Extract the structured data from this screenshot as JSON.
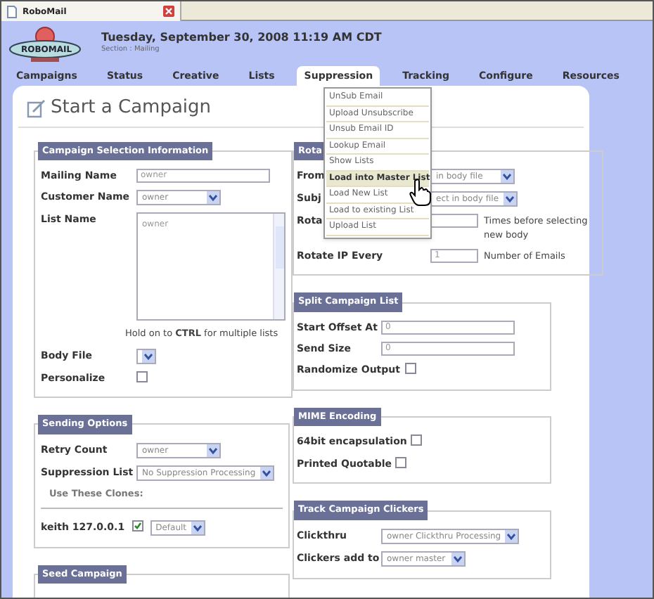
{
  "browser_tab": {
    "title": "RoboMail"
  },
  "header": {
    "logo": "ROBOMAIL",
    "date": "Tuesday, September 30, 2008 11:19 AM CDT",
    "section": "Section : Mailing"
  },
  "nav": [
    {
      "label": "Campaigns",
      "selected": false
    },
    {
      "label": "Status",
      "selected": false
    },
    {
      "label": "Creative",
      "selected": false
    },
    {
      "label": "Lists",
      "selected": false
    },
    {
      "label": "Suppression",
      "selected": true
    },
    {
      "label": "Tracking",
      "selected": false
    },
    {
      "label": "Configure",
      "selected": false
    },
    {
      "label": "Resources",
      "selected": false
    }
  ],
  "menu": {
    "items": [
      {
        "label": "UnSub Email",
        "hovered": false
      },
      {
        "label": "Upload Unsubscribe",
        "hovered": false
      },
      {
        "label": "Unsub Email ID",
        "hovered": false
      },
      {
        "label": "Lookup Email",
        "hovered": false
      },
      {
        "label": "Show Lists",
        "hovered": false
      },
      {
        "label": "Load into Master List",
        "hovered": true
      },
      {
        "label": "Load New List",
        "hovered": false
      },
      {
        "label": "Load to existing List",
        "hovered": false
      },
      {
        "label": "Upload List",
        "hovered": false
      }
    ]
  },
  "page_title": "Start a Campaign",
  "left_sections": [
    {
      "legend": "Campaign Selection Information",
      "rows": [
        {
          "kind": "text",
          "label": "Mailing Name",
          "value": "owner"
        },
        {
          "kind": "select",
          "label": "Customer Name",
          "value": "owner"
        },
        {
          "kind": "listbox",
          "label": "List Name",
          "items": [
            "owner"
          ]
        },
        {
          "kind": "note",
          "text": "Hold on to **CTRL** for multiple lists"
        },
        {
          "kind": "select",
          "label": "Body File"
        },
        {
          "kind": "checkbox",
          "label": "Personalize",
          "checked": false
        }
      ]
    },
    {
      "legend": "Sending Options",
      "rows": [
        {
          "kind": "select",
          "label": "Retry Count",
          "value": "owner"
        },
        {
          "kind": "select",
          "label": "Suppression List",
          "value": "No Suppression Processing"
        },
        {
          "kind": "subheading",
          "text": "Use These Clones:"
        },
        {
          "kind": "clone",
          "label": "keith 127.0.0.1",
          "checked": true,
          "value": "Default"
        }
      ]
    },
    {
      "legend": "Seed Campaign"
    }
  ],
  "right_sections": [
    {
      "legend": "Rota",
      "rows": [
        {
          "kind": "select",
          "label": "From",
          "value": "in body file"
        },
        {
          "kind": "select",
          "label": "Subj",
          "value": "ect in body file"
        },
        {
          "kind": "text",
          "label": "Rota",
          "suffix": "Times before selecting new body"
        },
        {
          "kind": "text",
          "label": "Rotate IP Every",
          "value": "1",
          "suffix": "Number of Emails"
        }
      ]
    },
    {
      "legend": "Split Campaign List",
      "rows": [
        {
          "kind": "text",
          "label": "Start Offset At",
          "value": "0"
        },
        {
          "kind": "text",
          "label": "Send Size",
          "value": "0"
        },
        {
          "kind": "inline_checkbox",
          "label": "Randomize Output",
          "checked": false
        }
      ]
    },
    {
      "legend": "MIME Encoding",
      "rows": [
        {
          "kind": "inline_checkbox",
          "label": "64bit encapsulation",
          "checked": false
        },
        {
          "kind": "inline_checkbox",
          "label": "Printed Quotable",
          "checked": false
        }
      ]
    },
    {
      "legend": "Track Campaign Clickers",
      "rows": [
        {
          "kind": "select",
          "label": "Clickthru",
          "value": "owner  Clickthru Processing"
        },
        {
          "kind": "select",
          "label": "Clickers add to",
          "value": "owner  master"
        }
      ]
    }
  ]
}
